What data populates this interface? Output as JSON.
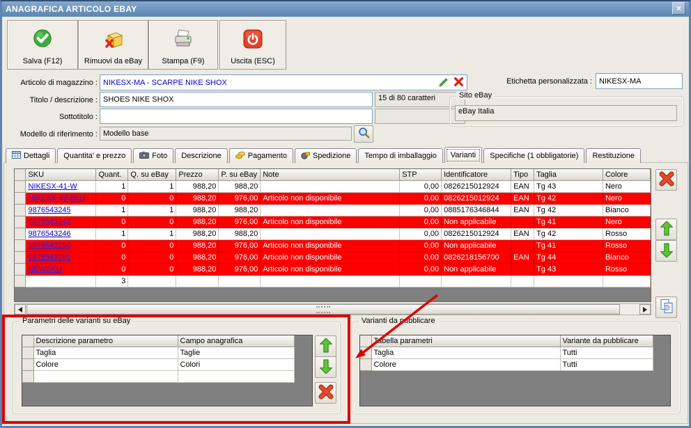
{
  "window": {
    "title": "ANAGRAFICA ARTICOLO EBAY",
    "close_glyph": "×"
  },
  "colors": {
    "annotation_red": "#de0000",
    "alert_row": "#ff0000",
    "link_blue": "#0000cc",
    "titlebar_blue": "#6a92bc"
  },
  "toolbar": {
    "save_label": "Salva (F12)",
    "remove_label": "Rimuovi da eBay",
    "print_label": "Stampa (F9)",
    "exit_label": "Uscita (ESC)"
  },
  "form": {
    "articolo_label": "Articolo di magazzino :",
    "articolo_value": "NIKESX-MA - SCARPE NIKE SHOX",
    "titolo_label": "Titolo / descrizione :",
    "titolo_value": "SHOES NIKE SHOX",
    "caratteri_counter": "15 di 80 caratteri",
    "sottotitolo_label": "Sottotitolo :",
    "sottotitolo_value": "",
    "modello_label": "Modello di riferimento :",
    "modello_value": "Modello base",
    "etichetta_label": "Etichetta personalizzata :",
    "etichetta_value": "NIKESX-MA",
    "sito_group_title": "Sito eBay",
    "sito_value": "eBay Italia"
  },
  "tabs": [
    {
      "label": "Dettagli"
    },
    {
      "label": "Quantita' e prezzo"
    },
    {
      "label": "Foto"
    },
    {
      "label": "Descrizione"
    },
    {
      "label": "Pagamento"
    },
    {
      "label": "Spedizione"
    },
    {
      "label": "Tempo di imballaggio"
    },
    {
      "label": "Varianti"
    },
    {
      "label": "Specifiche (1 obbligatorie)"
    },
    {
      "label": "Restituzione"
    }
  ],
  "table": {
    "headers": [
      "SKU",
      "Quant.",
      "Q. su eBay",
      "Prezzo",
      "P. su eBay",
      "Note",
      "STP",
      "Identificatore",
      "Tipo",
      "Taglia",
      "Colore"
    ],
    "rows": [
      {
        "sku": "NIKESX-41-W",
        "q": "1",
        "qe": "1",
        "p": "988,20",
        "pe": "988,20",
        "note": "",
        "stp": "0,00",
        "id": "0826215012924",
        "tipo": "EAN",
        "taglia": "Tg 43",
        "colore": "Nero"
      },
      {
        "sku": "NIKESX-42-BLU",
        "q": "0",
        "qe": "0",
        "p": "988,20",
        "pe": "976,00",
        "note": "Articolo non disponibile",
        "stp": "0,00",
        "id": "0826215012924",
        "tipo": "EAN",
        "taglia": "Tg 42",
        "colore": "Nero"
      },
      {
        "sku": "9876543245",
        "q": "1",
        "qe": "1",
        "p": "988,20",
        "pe": "988,20",
        "note": "",
        "stp": "0,00",
        "id": "0885176346844",
        "tipo": "EAN",
        "taglia": "Tg 42",
        "colore": "Bianco"
      },
      {
        "sku": "9876543244",
        "q": "0",
        "qe": "0",
        "p": "988,20",
        "pe": "976,00",
        "note": "Articolo non disponibile",
        "stp": "0,00",
        "id": "Non applicabile",
        "tipo": "",
        "taglia": "Tg 41",
        "colore": "Nero"
      },
      {
        "sku": "9876543246",
        "q": "1",
        "qe": "1",
        "p": "988,20",
        "pe": "988,20",
        "note": "",
        "stp": "0,00",
        "id": "0826215012924",
        "tipo": "EAN",
        "taglia": "Tg 42",
        "colore": "Rosso"
      },
      {
        "sku": "9876543290",
        "q": "0",
        "qe": "0",
        "p": "988,20",
        "pe": "976,00",
        "note": "Articolo non disponibile",
        "stp": "0,00",
        "id": "Non applicabile",
        "tipo": "",
        "taglia": "Tg 41",
        "colore": "Rosso"
      },
      {
        "sku": "9876543291",
        "q": "0",
        "qe": "0",
        "p": "988,20",
        "pe": "976,00",
        "note": "Articolo non disponibile",
        "stp": "0,00",
        "id": "0826218156700",
        "tipo": "EAN",
        "taglia": "Tg 44",
        "colore": "Bianco"
      },
      {
        "sku": "NEWSKU",
        "q": "0",
        "qe": "0",
        "p": "988,20",
        "pe": "976,00",
        "note": "Articolo non disponibile",
        "stp": "0,00",
        "id": "Non applicabile",
        "tipo": "",
        "taglia": "Tg 43",
        "colore": "Rosso"
      }
    ],
    "total_quant": "3"
  },
  "params_group": {
    "title": "Parametri delle varianti su eBay",
    "headers": [
      "Descrizione parametro",
      "Campo anagrafica"
    ],
    "rows": [
      [
        "Taglia",
        "Taglie"
      ],
      [
        "Colore",
        "Colori"
      ]
    ]
  },
  "publish_group": {
    "title": "Varianti da pubblicare",
    "headers": [
      "Tabella parametri",
      "Variante da pubblicare"
    ],
    "rows": [
      [
        "Taglia",
        "Tutti"
      ],
      [
        "Colore",
        "Tutti"
      ]
    ]
  }
}
